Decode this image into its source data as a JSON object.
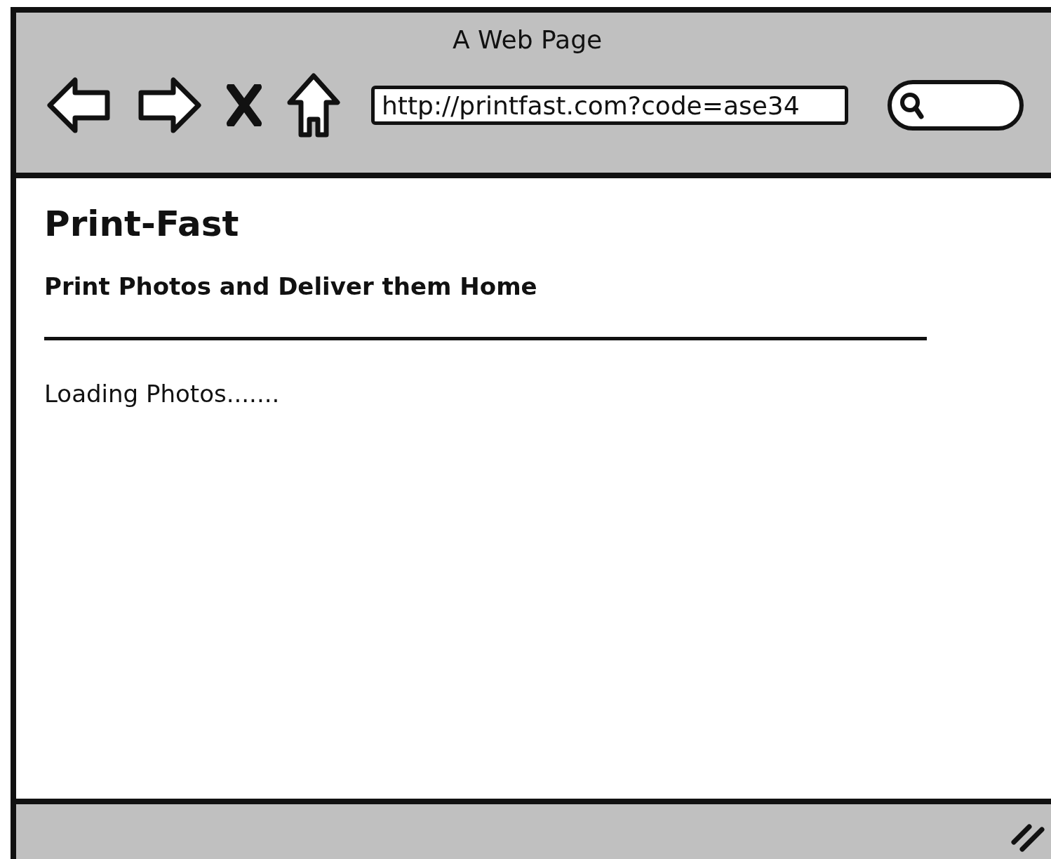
{
  "window": {
    "title": "A Web Page"
  },
  "toolbar": {
    "url": "http://printfast.com?code=ase34"
  },
  "page": {
    "title": "Print-Fast",
    "subtitle": "Print Photos and Deliver them Home",
    "status": "Loading Photos......."
  }
}
